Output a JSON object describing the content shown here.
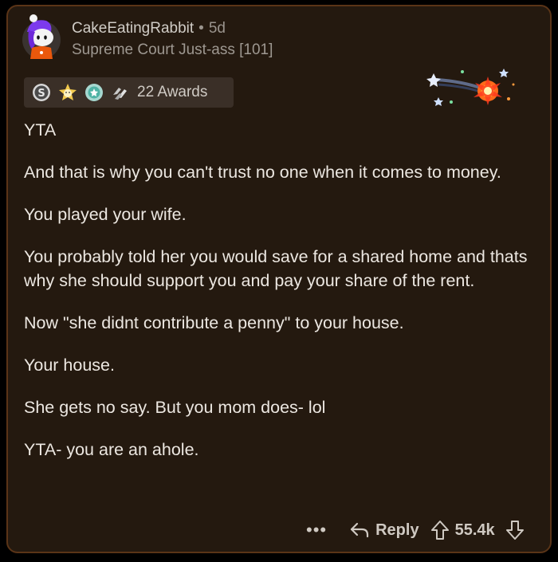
{
  "comment": {
    "author": "CakeEatingRabbit",
    "separator": "•",
    "age": "5d",
    "flair": "Supreme Court Just-ass [101]",
    "awards_label": "22 Awards",
    "award_icons": [
      "silver-award-icon",
      "helpful-award-icon",
      "wholesome-award-icon",
      "hands-award-icon"
    ],
    "paragraphs": [
      "YTA",
      "And that is why you can't trust no one when it comes to money.",
      "You played your wife.",
      "You probably told her you would save for a shared home and thats why she should support you and pay your share of the rent.",
      "Now \"she didnt contribute a penny\" to your house.",
      "Your house.",
      "She gets no say. But you mom does- lol",
      "YTA- you are an ahole."
    ]
  },
  "actions": {
    "more": "•••",
    "reply_label": "Reply",
    "score": "55.4k"
  },
  "colors": {
    "background": "#24190f",
    "border": "#5a3417",
    "text": "#ece7e1",
    "muted": "#9e9891"
  }
}
